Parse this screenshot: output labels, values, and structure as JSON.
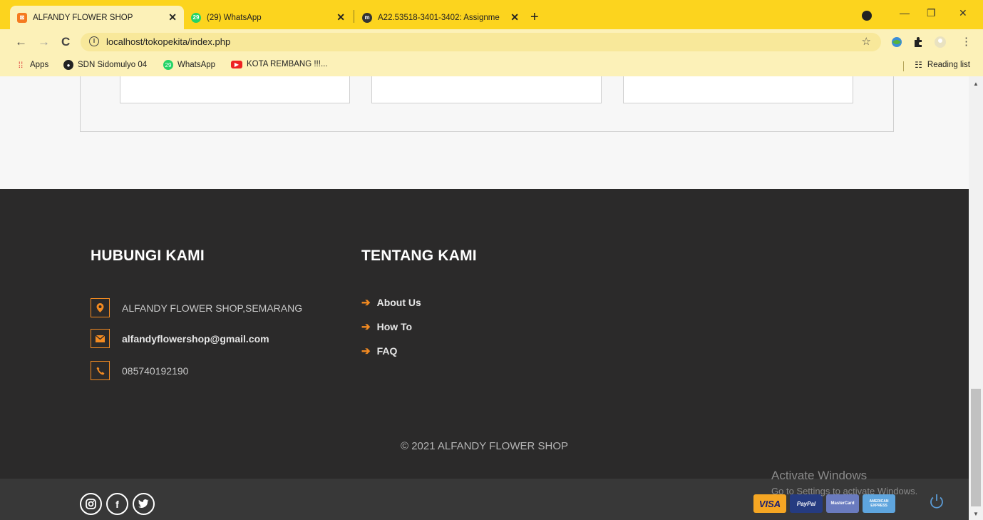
{
  "browser": {
    "tabs": [
      {
        "title": "ALFANDY FLOWER SHOP",
        "active": true
      },
      {
        "title": "(29) WhatsApp",
        "active": false,
        "badge": "29"
      },
      {
        "title": "A22.53518-3401-3402: Assignme",
        "active": false
      }
    ],
    "url": "localhost/tokopekita/index.php",
    "bookmarks": [
      "Apps",
      "SDN Sidomulyo 04",
      "WhatsApp",
      "KOTA REMBANG !!!..."
    ],
    "reading_list": "Reading list"
  },
  "footer": {
    "contact_heading": "HUBUNGI KAMI",
    "about_heading": "TENTANG KAMI",
    "address": "ALFANDY FLOWER SHOP,SEMARANG",
    "email": "alfandyflowershop@gmail.com",
    "phone": "085740192190",
    "links": [
      "About Us",
      "How To",
      "FAQ"
    ],
    "copyright": "© 2021 ALFANDY FLOWER SHOP"
  },
  "payments": {
    "visa": "VISA",
    "paypal": "PayPal",
    "mastercard": "MasterCard",
    "amex": "AMERICAN EXPRESS"
  },
  "overlay": {
    "activate_title": "Activate Windows",
    "activate_sub": "Go to Settings to activate Windows."
  },
  "colors": {
    "chrome": "#fcd41e",
    "footer_bg": "#2b2a2a",
    "accent": "#f28a21"
  }
}
